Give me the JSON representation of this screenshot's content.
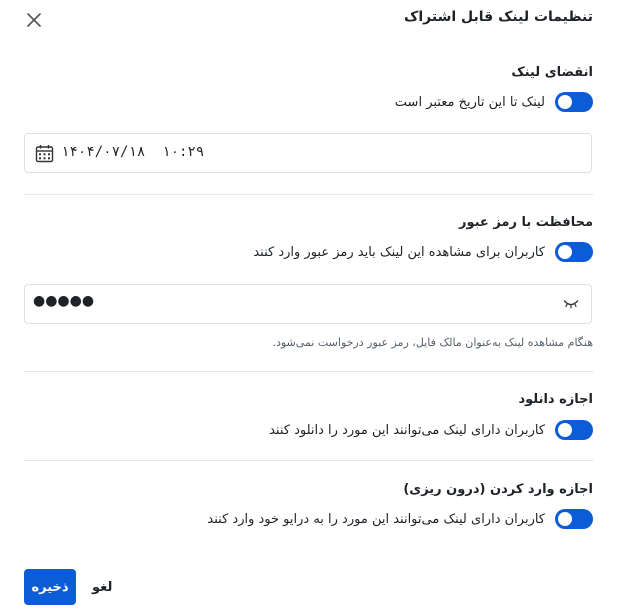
{
  "dialog": {
    "title": "تنظیمات لینک قابل اشتراک",
    "close_icon": "close-icon"
  },
  "expiry": {
    "title": "انقضای لینک",
    "toggle_label": "لینک تا این تاریخ معتبر است",
    "toggle_on": true,
    "datetime_value": "۱۴۰۴/۰۷/۱۸  ۱۰:۲۹",
    "calendar_icon": "calendar-icon"
  },
  "password": {
    "title": "محافظت با رمز عبور",
    "toggle_label": "کاربران برای مشاهده این لینک باید رمز عبور وارد کنند",
    "toggle_on": true,
    "masked_value": "●●●●●",
    "visibility_icon": "eye-closed-icon",
    "hint": "هنگام مشاهده لینک به‌عنوان مالک فایل، رمز عبور درخواست نمی‌شود."
  },
  "download": {
    "title": "اجازه دانلود",
    "toggle_label": "کاربران دارای لینک می‌توانند این مورد را دانلود کنند",
    "toggle_on": true
  },
  "import": {
    "title": "اجازه وارد کردن (درون ریزی)",
    "toggle_label": "کاربران دارای لینک می‌توانند این مورد را به درایو خود وارد کنند",
    "toggle_on": true
  },
  "footer": {
    "save_label": "ذخیره",
    "cancel_label": "لغو"
  },
  "colors": {
    "accent": "#0b5cd6",
    "divider": "#e6e8eb",
    "border": "#dcdfe4",
    "hint_text": "#57606a"
  }
}
